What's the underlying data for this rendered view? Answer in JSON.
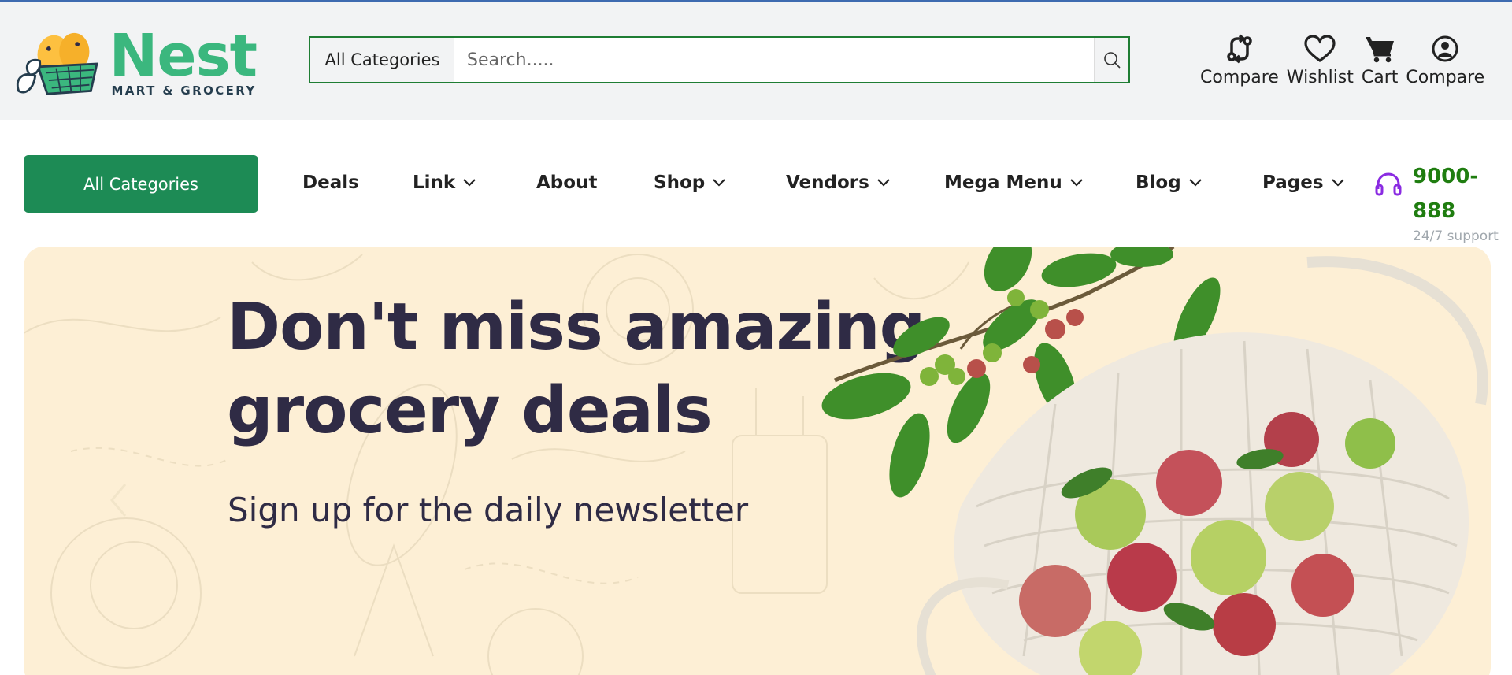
{
  "brand": {
    "name": "Nest",
    "tagline": "MART & GROCERY"
  },
  "search": {
    "category": "All Categories",
    "placeholder": "Search.....",
    "value": ""
  },
  "header_actions": [
    {
      "label": "Compare",
      "icon": "compare-icon"
    },
    {
      "label": "Wishlist",
      "icon": "heart-icon"
    },
    {
      "label": "Cart",
      "icon": "cart-icon"
    },
    {
      "label": "Compare",
      "icon": "user-icon"
    }
  ],
  "nav": {
    "all_categories": "All Categories",
    "items": [
      {
        "label": "Deals",
        "dropdown": false
      },
      {
        "label": "Link",
        "dropdown": true
      },
      {
        "label": "About",
        "dropdown": false
      },
      {
        "label": "Shop",
        "dropdown": true
      },
      {
        "label": "Vendors",
        "dropdown": true
      },
      {
        "label": "Mega Menu",
        "dropdown": true
      },
      {
        "label": "Blog",
        "dropdown": true
      },
      {
        "label": "Pages",
        "dropdown": true
      }
    ],
    "support_number": "9000-888",
    "support_label": "24/7 support"
  },
  "hero": {
    "title": "Don't miss amazing grocery deals",
    "subtitle": "Sign up for the daily newsletter"
  },
  "colors": {
    "brand_green": "#3bb77e",
    "button_green": "#1d8b55",
    "search_border": "#1f7d33",
    "support_green": "#1f7d10",
    "headset_purple": "#8a2be2",
    "hero_bg": "#fdefd5",
    "hero_text": "#2f2b45"
  }
}
